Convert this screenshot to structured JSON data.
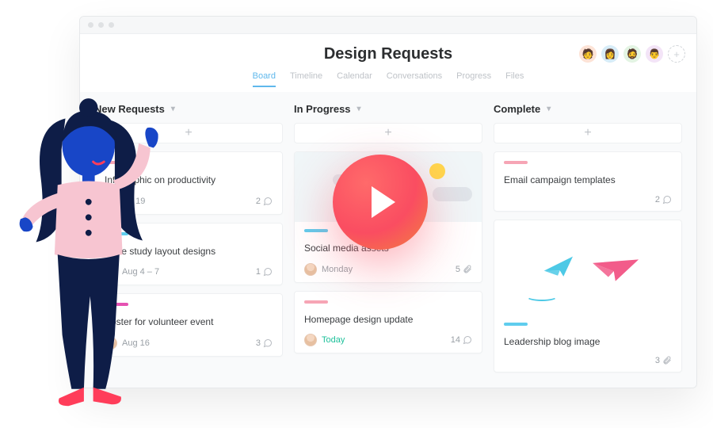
{
  "header": {
    "title": "Design Requests",
    "tabs": [
      "Board",
      "Timeline",
      "Calendar",
      "Conversations",
      "Progress",
      "Files"
    ],
    "active_tab": 0
  },
  "columns": [
    {
      "title": "New Requests",
      "cards": [
        {
          "tag_color": "#f6a5b5",
          "title": "Infographic on productivity",
          "date": "Jul 19",
          "meta_count": 2,
          "meta_icon": "chat"
        },
        {
          "tag_color": "#5fcdee",
          "title": "Case study layout designs",
          "date": "Aug 4 – 7",
          "meta_count": 1,
          "meta_icon": "chat"
        },
        {
          "tag_color": "#e552b2",
          "title": "Poster for volunteer event",
          "date": "Aug 16",
          "meta_count": 3,
          "meta_icon": "chat"
        }
      ]
    },
    {
      "title": "In Progress",
      "cards": [
        {
          "type": "image",
          "image": "trees",
          "tag_color": "#5fcdee",
          "title": "Social media assets",
          "date": "Monday",
          "meta_count": 5,
          "meta_icon": "clip"
        },
        {
          "tag_color": "#f6a5b5",
          "title": "Homepage design update",
          "date": "Today",
          "date_class": "today",
          "meta_count": 14,
          "meta_icon": "chat"
        }
      ]
    },
    {
      "title": "Complete",
      "cards": [
        {
          "tag_color": "#f6a5b5",
          "title": "Email campaign templates",
          "date": "",
          "meta_count": 2,
          "meta_icon": "chat"
        },
        {
          "type": "image",
          "image": "planes",
          "tag_color": "#5fcdee",
          "title": "Leadership blog image",
          "date": "",
          "meta_count": 3,
          "meta_icon": "clip"
        }
      ]
    }
  ],
  "labels": {
    "add_card": "+",
    "add_member": "+"
  }
}
